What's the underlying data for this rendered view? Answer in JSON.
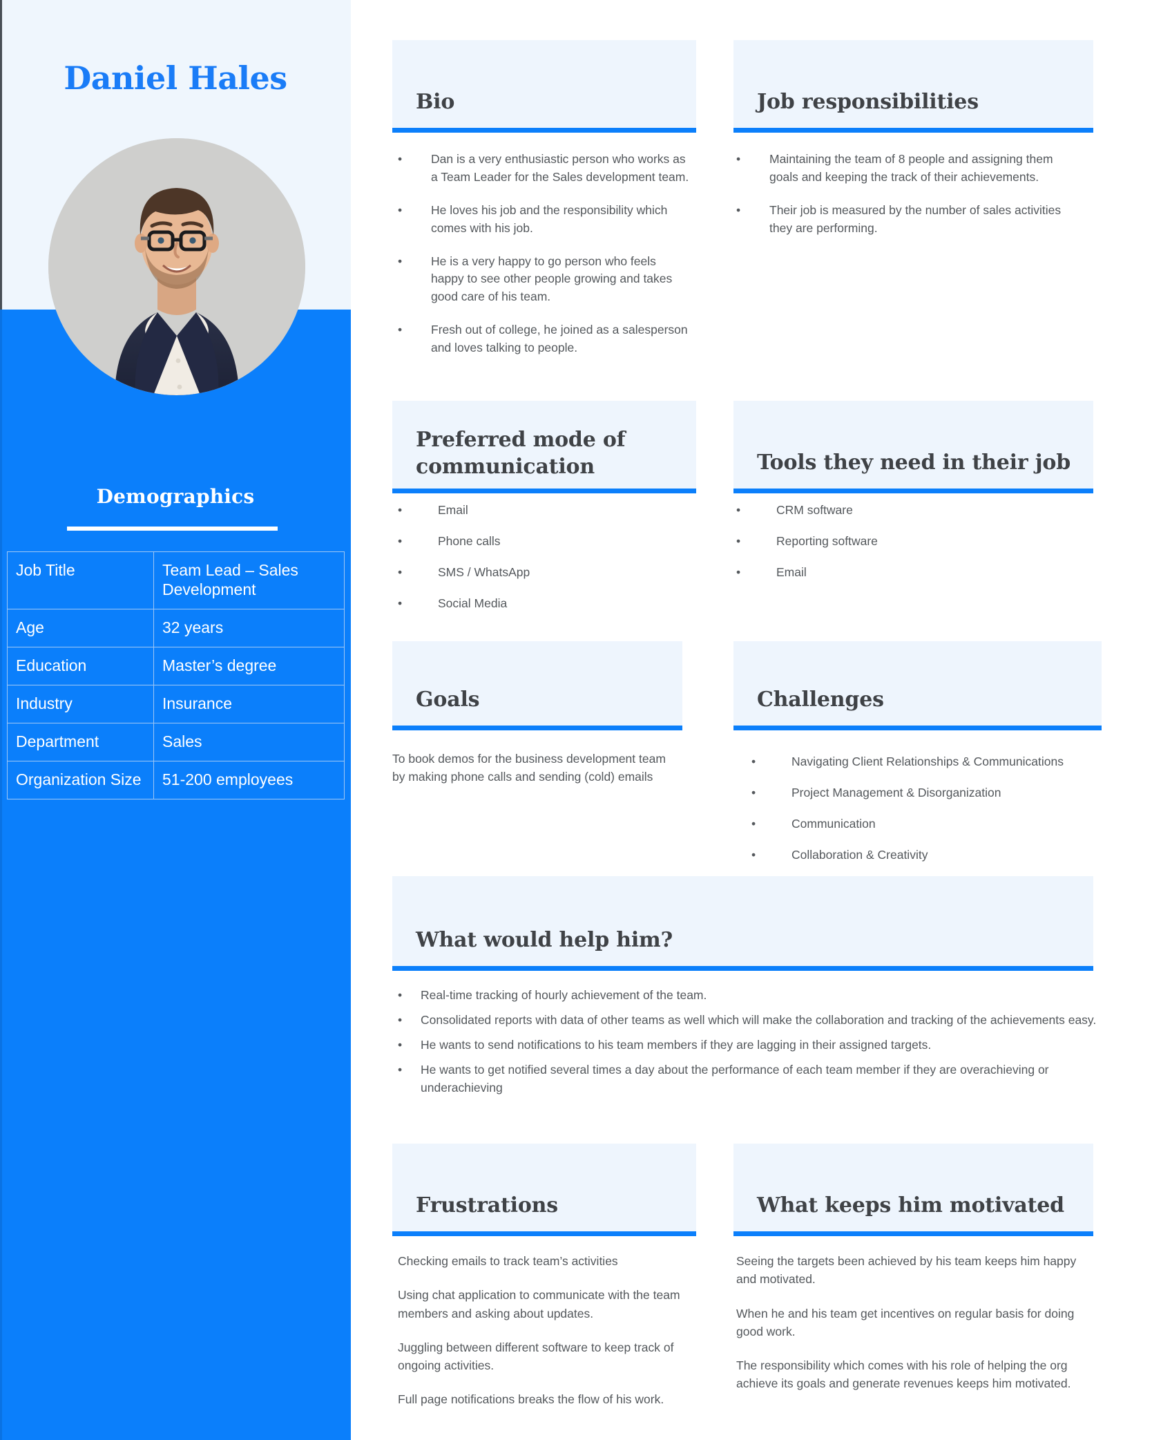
{
  "persona": {
    "name": "Daniel Hales",
    "avatar_alt": "portrait-photo"
  },
  "colors": {
    "brand_blue": "#0b7ffb",
    "name_blue": "#1a7cf7",
    "card_header_bg": "#eef5fd",
    "sidebar_light": "#eff6fd",
    "body_text": "#54585c",
    "heading_text": "#3f4246"
  },
  "demographics": {
    "title": "Demographics",
    "rows": [
      {
        "key": "Job Title",
        "value": "Team Lead – Sales Development"
      },
      {
        "key": "Age",
        "value": "32 years"
      },
      {
        "key": "Education",
        "value": "Master’s degree"
      },
      {
        "key": "Industry",
        "value": "Insurance"
      },
      {
        "key": "Department",
        "value": "Sales"
      },
      {
        "key": "Organization Size",
        "value": "51-200 employees"
      }
    ]
  },
  "bio": {
    "title": "Bio",
    "items": [
      "Dan is a very enthusiastic person who works as a Team Leader for the Sales development team.",
      "He loves his job and the responsibility which comes with his job.",
      "He is a very happy to go person who feels happy to see other people growing and takes good care of his team.",
      "Fresh out of college, he joined as a salesperson and loves talking to people."
    ]
  },
  "job_responsibilities": {
    "title": "Job responsibilities",
    "items": [
      "Maintaining the team of 8 people and assigning them goals and keeping the track of their achievements.",
      "Their job is measured by the number of sales activities they are performing."
    ]
  },
  "communication": {
    "title": "Preferred mode of communication",
    "items": [
      "Email",
      "Phone calls",
      "SMS / WhatsApp",
      "Social Media"
    ]
  },
  "tools": {
    "title": "Tools they need in their job",
    "items": [
      "CRM software",
      "Reporting software",
      "Email"
    ]
  },
  "goals": {
    "title": "Goals",
    "text": "To book demos for the business development team by making phone calls and sending (cold) emails"
  },
  "challenges": {
    "title": "Challenges",
    "items": [
      "Navigating Client Relationships & Communications",
      "Project Management & Disorganization",
      "Communication",
      "Collaboration & Creativity"
    ]
  },
  "help": {
    "title": "What would help him?",
    "items": [
      "Real-time tracking of hourly achievement of the team.",
      "Consolidated reports with data of other teams as well which will make the collaboration and tracking of the achievements easy.",
      "He wants to send notifications to his team members if they are lagging in their assigned targets.",
      "He wants to get notified several times a day about the performance of each team member if they are overachieving or underachieving"
    ]
  },
  "frustrations": {
    "title": "Frustrations",
    "items": [
      "Checking emails to track team’s activities",
      "Using chat application to communicate with the team members and asking about updates.",
      "Juggling between different software to keep track of ongoing activities.",
      "Full page notifications breaks the flow of his work."
    ]
  },
  "motivation": {
    "title": "What keeps him motivated",
    "items": [
      "Seeing the targets been achieved by his team keeps him happy and motivated.",
      "When he and his team get incentives on regular basis for doing good work.",
      "The responsibility which comes with his role of helping the org achieve its goals and generate revenues keeps him motivated."
    ]
  }
}
